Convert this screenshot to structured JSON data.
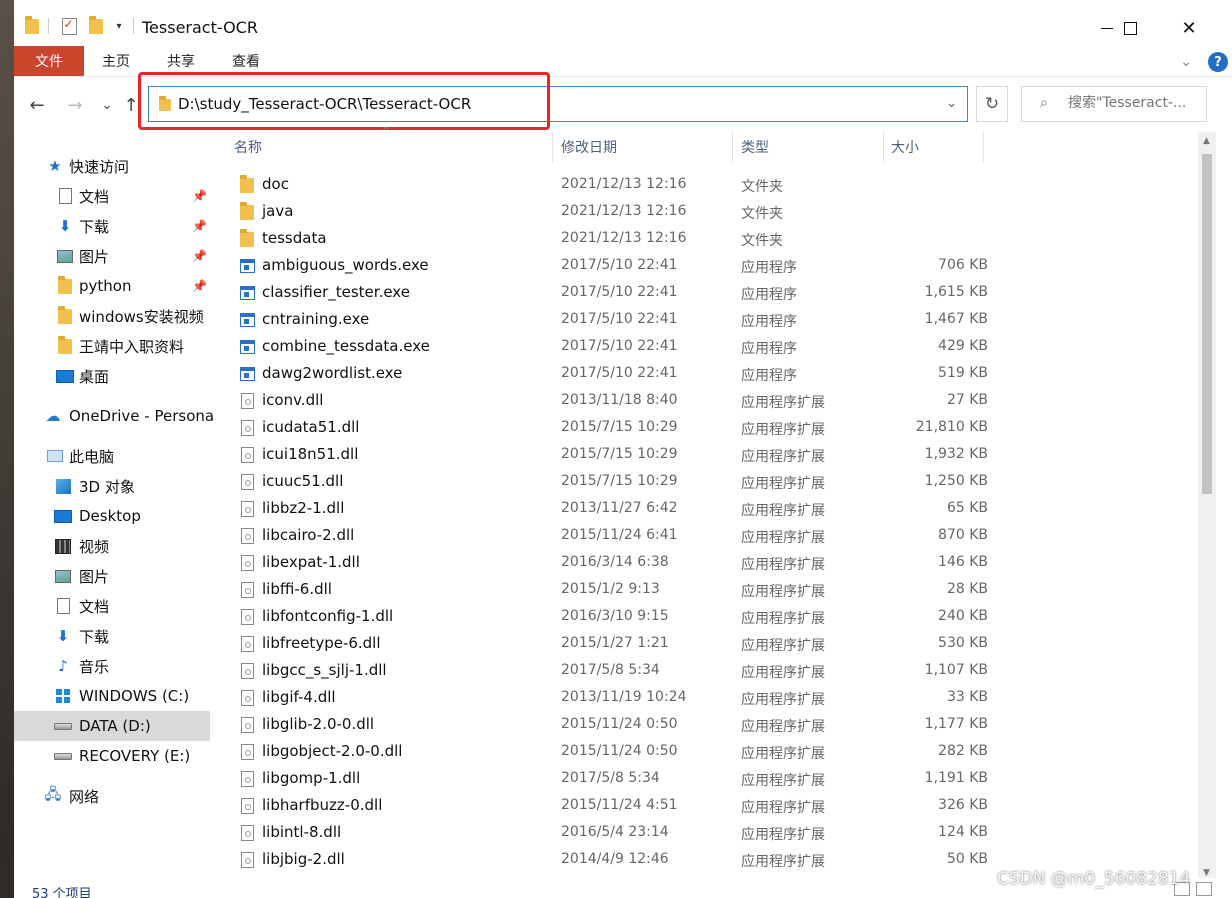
{
  "window": {
    "title": "Tesseract-OCR",
    "close_glyph": "✕"
  },
  "ribbon": {
    "tabs": [
      "文件",
      "主页",
      "共享",
      "查看"
    ],
    "help_glyph": "?",
    "expand_glyph": "⌄"
  },
  "navigation": {
    "back_glyph": "←",
    "forward_glyph": "→",
    "recent_glyph": "⌄",
    "up_glyph": "↑"
  },
  "address": {
    "path": "D:\\study_Tesseract-OCR\\Tesseract-OCR",
    "dropdown_glyph": "⌄"
  },
  "refresh_glyph": "↻",
  "search": {
    "icon": "⌕",
    "placeholder": "搜索\"Tesseract-..."
  },
  "sidebar": {
    "items": [
      {
        "label": "快速访问",
        "icon": "star-icon",
        "pinned": false
      },
      {
        "label": "文档",
        "icon": "document-icon",
        "pinned": true
      },
      {
        "label": "下载",
        "icon": "download-icon",
        "pinned": true
      },
      {
        "label": "图片",
        "icon": "pictures-icon",
        "pinned": true
      },
      {
        "label": "python",
        "icon": "folder-icon",
        "pinned": true
      },
      {
        "label": "windows安装视频",
        "icon": "folder-icon",
        "pinned": false
      },
      {
        "label": "王靖中入职资料",
        "icon": "folder-icon",
        "pinned": false
      },
      {
        "label": "桌面",
        "icon": "desktop-icon",
        "pinned": false
      },
      {
        "label": "OneDrive - Persona",
        "icon": "cloud-icon",
        "pinned": false
      },
      {
        "label": "此电脑",
        "icon": "computer-icon",
        "pinned": false
      },
      {
        "label": "3D 对象",
        "icon": "3d-objects-icon",
        "pinned": false
      },
      {
        "label": "Desktop",
        "icon": "desktop-icon",
        "pinned": false
      },
      {
        "label": "视频",
        "icon": "video-icon",
        "pinned": false
      },
      {
        "label": "图片",
        "icon": "pictures-icon",
        "pinned": false
      },
      {
        "label": "文档",
        "icon": "document-icon",
        "pinned": false
      },
      {
        "label": "下载",
        "icon": "download-icon",
        "pinned": false
      },
      {
        "label": "音乐",
        "icon": "music-icon",
        "pinned": false
      },
      {
        "label": "WINDOWS (C:)",
        "icon": "windows-drive-icon",
        "pinned": false
      },
      {
        "label": "DATA (D:)",
        "icon": "drive-icon",
        "pinned": false,
        "selected": true
      },
      {
        "label": "RECOVERY (E:)",
        "icon": "drive-icon",
        "pinned": false
      },
      {
        "label": "网络",
        "icon": "network-icon",
        "pinned": false
      }
    ],
    "pin_glyph": "📌"
  },
  "columns": [
    "名称",
    "修改日期",
    "类型",
    "大小"
  ],
  "files": [
    {
      "name": "doc",
      "date": "2021/12/13 12:16",
      "type": "文件夹",
      "size": "",
      "kind": "folder"
    },
    {
      "name": "java",
      "date": "2021/12/13 12:16",
      "type": "文件夹",
      "size": "",
      "kind": "folder"
    },
    {
      "name": "tessdata",
      "date": "2021/12/13 12:16",
      "type": "文件夹",
      "size": "",
      "kind": "folder"
    },
    {
      "name": "ambiguous_words.exe",
      "date": "2017/5/10 22:41",
      "type": "应用程序",
      "size": "706 KB",
      "kind": "exe"
    },
    {
      "name": "classifier_tester.exe",
      "date": "2017/5/10 22:41",
      "type": "应用程序",
      "size": "1,615 KB",
      "kind": "exe"
    },
    {
      "name": "cntraining.exe",
      "date": "2017/5/10 22:41",
      "type": "应用程序",
      "size": "1,467 KB",
      "kind": "exe"
    },
    {
      "name": "combine_tessdata.exe",
      "date": "2017/5/10 22:41",
      "type": "应用程序",
      "size": "429 KB",
      "kind": "exe"
    },
    {
      "name": "dawg2wordlist.exe",
      "date": "2017/5/10 22:41",
      "type": "应用程序",
      "size": "519 KB",
      "kind": "exe"
    },
    {
      "name": "iconv.dll",
      "date": "2013/11/18 8:40",
      "type": "应用程序扩展",
      "size": "27 KB",
      "kind": "dll"
    },
    {
      "name": "icudata51.dll",
      "date": "2015/7/15 10:29",
      "type": "应用程序扩展",
      "size": "21,810 KB",
      "kind": "dll"
    },
    {
      "name": "icui18n51.dll",
      "date": "2015/7/15 10:29",
      "type": "应用程序扩展",
      "size": "1,932 KB",
      "kind": "dll"
    },
    {
      "name": "icuuc51.dll",
      "date": "2015/7/15 10:29",
      "type": "应用程序扩展",
      "size": "1,250 KB",
      "kind": "dll"
    },
    {
      "name": "libbz2-1.dll",
      "date": "2013/11/27 6:42",
      "type": "应用程序扩展",
      "size": "65 KB",
      "kind": "dll"
    },
    {
      "name": "libcairo-2.dll",
      "date": "2015/11/24 6:41",
      "type": "应用程序扩展",
      "size": "870 KB",
      "kind": "dll"
    },
    {
      "name": "libexpat-1.dll",
      "date": "2016/3/14 6:38",
      "type": "应用程序扩展",
      "size": "146 KB",
      "kind": "dll"
    },
    {
      "name": "libffi-6.dll",
      "date": "2015/1/2 9:13",
      "type": "应用程序扩展",
      "size": "28 KB",
      "kind": "dll"
    },
    {
      "name": "libfontconfig-1.dll",
      "date": "2016/3/10 9:15",
      "type": "应用程序扩展",
      "size": "240 KB",
      "kind": "dll"
    },
    {
      "name": "libfreetype-6.dll",
      "date": "2015/1/27 1:21",
      "type": "应用程序扩展",
      "size": "530 KB",
      "kind": "dll"
    },
    {
      "name": "libgcc_s_sjlj-1.dll",
      "date": "2017/5/8 5:34",
      "type": "应用程序扩展",
      "size": "1,107 KB",
      "kind": "dll"
    },
    {
      "name": "libgif-4.dll",
      "date": "2013/11/19 10:24",
      "type": "应用程序扩展",
      "size": "33 KB",
      "kind": "dll"
    },
    {
      "name": "libglib-2.0-0.dll",
      "date": "2015/11/24 0:50",
      "type": "应用程序扩展",
      "size": "1,177 KB",
      "kind": "dll"
    },
    {
      "name": "libgobject-2.0-0.dll",
      "date": "2015/11/24 0:50",
      "type": "应用程序扩展",
      "size": "282 KB",
      "kind": "dll"
    },
    {
      "name": "libgomp-1.dll",
      "date": "2017/5/8 5:34",
      "type": "应用程序扩展",
      "size": "1,191 KB",
      "kind": "dll"
    },
    {
      "name": "libharfbuzz-0.dll",
      "date": "2015/11/24 4:51",
      "type": "应用程序扩展",
      "size": "326 KB",
      "kind": "dll"
    },
    {
      "name": "libintl-8.dll",
      "date": "2016/5/4 23:14",
      "type": "应用程序扩展",
      "size": "124 KB",
      "kind": "dll"
    },
    {
      "name": "libjbig-2.dll",
      "date": "2014/4/9 12:46",
      "type": "应用程序扩展",
      "size": "50 KB",
      "kind": "dll"
    }
  ],
  "status": {
    "item_count": "53 个项目"
  },
  "watermark": "CSDN @m0_56082814",
  "colors": {
    "file_tab": "#c9462c",
    "accent": "#1f6fc7",
    "highlight_box": "#e8262a",
    "selected_nav": "#d9d9d9"
  }
}
